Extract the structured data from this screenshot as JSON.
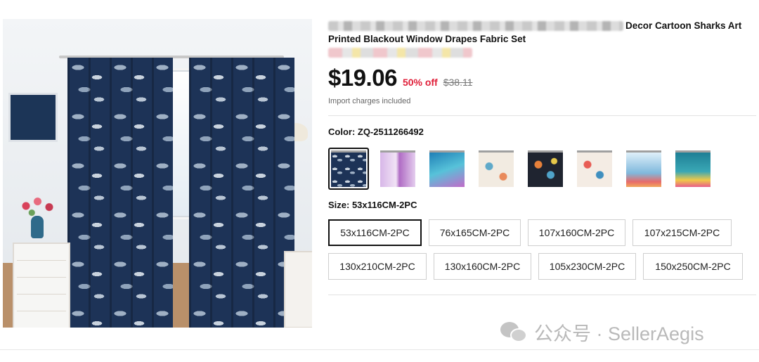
{
  "product": {
    "title_end": "Decor Cartoon Sharks Art",
    "title_line2": "Printed Blackout Window Drapes Fabric Set"
  },
  "pricing": {
    "price": "$19.06",
    "discount": "50% off",
    "original": "$38.11",
    "import_note": "Import charges included"
  },
  "color": {
    "label": "Color: ZQ-2511266492",
    "swatches": [
      {
        "name": "navy-sharks",
        "color": "#1d3357",
        "selected": true
      },
      {
        "name": "purple-mermaid",
        "color": "#c99ad6"
      },
      {
        "name": "teal-ocean",
        "color": "#3aa3c8"
      },
      {
        "name": "pastel-sea",
        "color": "#e8d8c4"
      },
      {
        "name": "dark-floral-sea",
        "color": "#2b2f3a"
      },
      {
        "name": "coral-print",
        "color": "#e9cdbc"
      },
      {
        "name": "blue-seabed",
        "color": "#7fb8dc"
      },
      {
        "name": "teal-aquarium",
        "color": "#2f8fa0"
      }
    ]
  },
  "size": {
    "label": "Size: 53x116CM-2PC",
    "options": [
      "53x116CM-2PC",
      "76x165CM-2PC",
      "107x160CM-2PC",
      "107x215CM-2PC",
      "130x210CM-2PC",
      "130x160CM-2PC",
      "105x230CM-2PC",
      "150x250CM-2PC"
    ],
    "selected": "53x116CM-2PC"
  },
  "watermark": {
    "text": "公众号 · SellerAegis"
  }
}
